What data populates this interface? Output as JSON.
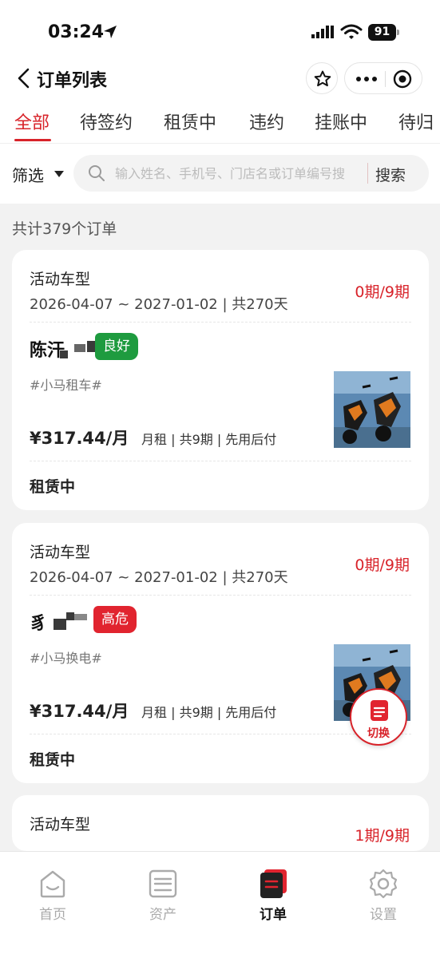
{
  "status_bar": {
    "time": "03:24",
    "battery": "91"
  },
  "nav": {
    "title": "订单列表"
  },
  "tabs": [
    {
      "label": "全部"
    },
    {
      "label": "待签约"
    },
    {
      "label": "租赁中"
    },
    {
      "label": "违约"
    },
    {
      "label": "挂账中"
    },
    {
      "label": "待归"
    }
  ],
  "filter": {
    "label": "筛选"
  },
  "search": {
    "placeholder": "输入姓名、手机号、门店名或订单编号搜",
    "button": "搜索"
  },
  "order_count": "共计379个订单",
  "orders": [
    {
      "type": "活动车型",
      "dates": "2026-04-07 ~ 2027-01-02  |  共270天",
      "term": "0期/9期",
      "name": "陈汗",
      "badge": "良好",
      "tag": "#小马租车#",
      "price": "¥317.44/月",
      "rent_info": "月租 | 共9期 | 先用后付",
      "status": "租赁中"
    },
    {
      "type": "活动车型",
      "dates": "2026-04-07 ~ 2027-01-02  |  共270天",
      "term": "0期/9期",
      "name": "豸",
      "badge": "高危",
      "tag": "#小马换电#",
      "price": "¥317.44/月",
      "rent_info": "月租 | 共9期 | 先用后付",
      "status": "租赁中"
    },
    {
      "type": "活动车型",
      "term": "1期/9期"
    }
  ],
  "switch_button": {
    "label": "切换"
  },
  "tab_bar": [
    {
      "label": "首页",
      "icon": "home-icon"
    },
    {
      "label": "资产",
      "icon": "assets-icon"
    },
    {
      "label": "订单",
      "icon": "orders-icon"
    },
    {
      "label": "设置",
      "icon": "settings-icon"
    }
  ],
  "colors": {
    "accent": "#d8232a",
    "good": "#1e9b3f",
    "danger": "#e1242f"
  }
}
